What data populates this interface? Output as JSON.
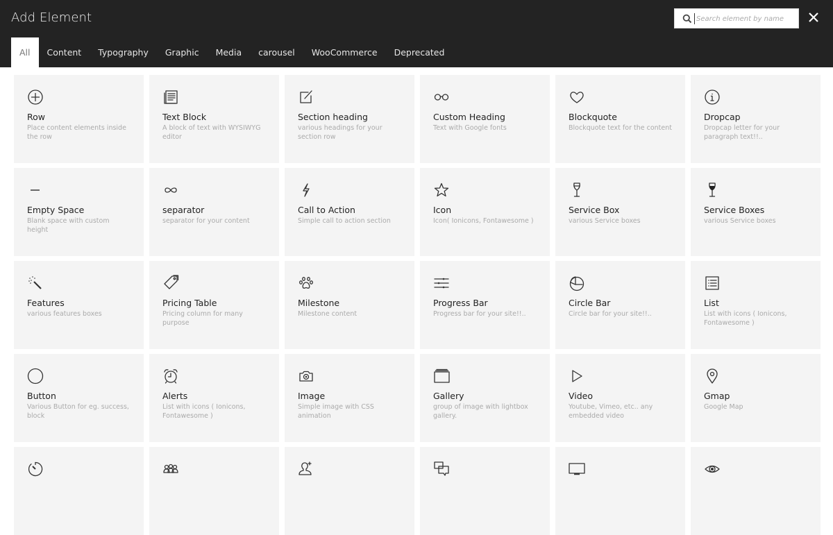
{
  "header": {
    "title": "Add Element",
    "search_placeholder": "Search element by name",
    "search_value": "",
    "close_icon": "close-icon",
    "search_icon": "search-icon"
  },
  "tabs": [
    {
      "label": "All",
      "active": true
    },
    {
      "label": "Content",
      "active": false
    },
    {
      "label": "Typography",
      "active": false
    },
    {
      "label": "Graphic",
      "active": false
    },
    {
      "label": "Media",
      "active": false
    },
    {
      "label": "carousel",
      "active": false
    },
    {
      "label": "WooCommerce",
      "active": false
    },
    {
      "label": "Deprecated",
      "active": false
    }
  ],
  "elements": [
    {
      "name": "Row",
      "desc": "Place content elements inside the row",
      "icon": "plus-circle-icon"
    },
    {
      "name": "Text Block",
      "desc": "A block of text with WYSIWYG editor",
      "icon": "document-icon"
    },
    {
      "name": "Section heading",
      "desc": "various headings for your section row",
      "icon": "edit-icon"
    },
    {
      "name": "Custom Heading",
      "desc": "Text with Google fonts",
      "icon": "glasses-icon"
    },
    {
      "name": "Blockquote",
      "desc": "Blockquote text for the content",
      "icon": "heart-icon"
    },
    {
      "name": "Dropcap",
      "desc": "Dropcap letter for your paragraph text!!..",
      "icon": "info-icon"
    },
    {
      "name": "Empty Space",
      "desc": "Blank space with custom height",
      "icon": "minus-icon"
    },
    {
      "name": "separator",
      "desc": "separator for your content",
      "icon": "infinity-icon"
    },
    {
      "name": "Call to Action",
      "desc": "Simple call to action section",
      "icon": "lightning-icon"
    },
    {
      "name": "Icon",
      "desc": "Icon( Ionicons, Fontawesome )",
      "icon": "star-icon"
    },
    {
      "name": "Service Box",
      "desc": "various Service boxes",
      "icon": "wineglass-outline-icon"
    },
    {
      "name": "Service Boxes",
      "desc": "various Service boxes",
      "icon": "wineglass-filled-icon"
    },
    {
      "name": "Features",
      "desc": "various features boxes",
      "icon": "magic-wand-icon"
    },
    {
      "name": "Pricing Table",
      "desc": "Pricing column for many purpose",
      "icon": "pricetag-icon"
    },
    {
      "name": "Milestone",
      "desc": "Milestone content",
      "icon": "paw-icon"
    },
    {
      "name": "Progress Bar",
      "desc": "Progress bar for your site!!..",
      "icon": "sliders-icon"
    },
    {
      "name": "Circle Bar",
      "desc": "Circle bar for your site!!..",
      "icon": "pie-chart-icon"
    },
    {
      "name": "List",
      "desc": "List with icons ( Ionicons, Fontawesome )",
      "icon": "list-icon"
    },
    {
      "name": "Button",
      "desc": "Various Button for eg. success, block",
      "icon": "circle-icon"
    },
    {
      "name": "Alerts",
      "desc": "List with icons ( Ionicons, Fontawesome )",
      "icon": "alarm-clock-icon"
    },
    {
      "name": "Image",
      "desc": "Simple image with CSS animation",
      "icon": "camera-icon"
    },
    {
      "name": "Gallery",
      "desc": "group of image with lightbox gallery.",
      "icon": "albums-icon"
    },
    {
      "name": "Video",
      "desc": "Youtube, Vimeo, etc.. any embedded video",
      "icon": "play-icon"
    },
    {
      "name": "Gmap",
      "desc": "Google Map",
      "icon": "location-pin-icon"
    },
    {
      "name": "",
      "desc": "",
      "icon": "timer-icon"
    },
    {
      "name": "",
      "desc": "",
      "icon": "people-icon"
    },
    {
      "name": "",
      "desc": "",
      "icon": "person-add-icon"
    },
    {
      "name": "",
      "desc": "",
      "icon": "chat-bubbles-icon"
    },
    {
      "name": "",
      "desc": "",
      "icon": "monitor-icon"
    },
    {
      "name": "",
      "desc": "",
      "icon": "eye-icon"
    }
  ]
}
